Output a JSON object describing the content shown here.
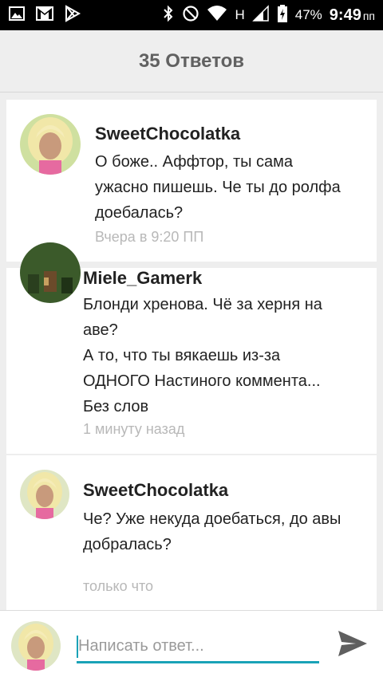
{
  "status_bar": {
    "network_type": "H",
    "battery": "47%",
    "time": "9:49",
    "time_suffix": "пп",
    "icons": [
      "gallery-icon",
      "gmail-icon",
      "play-store-icon",
      "bluetooth-icon",
      "do-not-disturb-icon",
      "wifi-icon",
      "signal-icon",
      "battery-charging-icon"
    ]
  },
  "header": {
    "title": "35 Ответов"
  },
  "replies": [
    {
      "author": "SweetChocolatka",
      "text": "О боже.. Аффтор, ты сама\nужасно пишешь. Че ты до ролфа\nдоебалась?",
      "time": "Вчера в 9:20 ПП"
    },
    {
      "author": "Miele_Gamerk",
      "text": "Блонди хренова. Чё за херня на\nаве?\nА то, что ты вякаешь из-за\nОДНОГО Настиного коммента...\nБез слов",
      "time": "1 минуту назад"
    },
    {
      "author": "SweetChocolatka",
      "text": "Че? Уже некуда доебаться, до авы\nдобралась?",
      "time": "только что"
    }
  ],
  "composer": {
    "placeholder": "Написать ответ...",
    "send_icon": "send-icon"
  },
  "colors": {
    "accent": "#1aa2b7",
    "status_bar": "#000000",
    "background": "#eeeeee",
    "timestamp": "#b8b8b8"
  }
}
